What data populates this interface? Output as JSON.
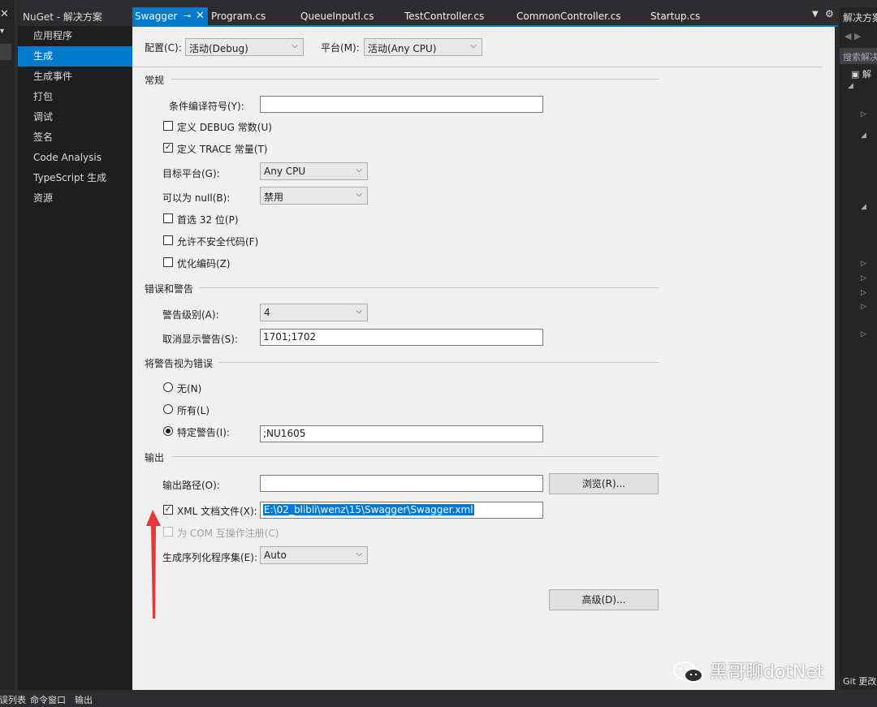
{
  "left_sliver": {
    "close_glyph": "✕",
    "dropdown_glyph": "▾"
  },
  "nuget_tab": {
    "label": "NuGet - 解决方案"
  },
  "project_nav": {
    "items": [
      "应用程序",
      "生成",
      "生成事件",
      "打包",
      "调试",
      "签名",
      "Code Analysis",
      "TypeScript 生成",
      "资源"
    ],
    "active_index": 1
  },
  "tabs": {
    "active": {
      "label": "Swagger",
      "pin": "⊸",
      "close": "✕"
    },
    "others": [
      "Program.cs",
      "QueueInputl.cs",
      "TestController.cs",
      "CommonController.cs",
      "Startup.cs"
    ],
    "menu_glyph": "▼",
    "gear_glyph": "⚙"
  },
  "config": {
    "config_label": "配置(C):",
    "config_value": "活动(Debug)",
    "platform_label": "平台(M):",
    "platform_value": "活动(Any CPU)"
  },
  "general": {
    "title": "常规",
    "conditional_label": "条件编译符号(Y):",
    "conditional_value": "",
    "define_debug": {
      "label": "定义 DEBUG 常数(U)",
      "checked": false
    },
    "define_trace": {
      "label": "定义 TRACE 常量(T)",
      "checked": true
    },
    "target_label": "目标平台(G):",
    "target_value": "Any CPU",
    "nullable_label": "可以为 null(B):",
    "nullable_value": "禁用",
    "prefer32": {
      "label": "首选 32 位(P)",
      "checked": false
    },
    "unsafe": {
      "label": "允许不安全代码(F)",
      "checked": false
    },
    "optimize": {
      "label": "优化编码(Z)",
      "checked": false
    }
  },
  "errors": {
    "title": "错误和警告",
    "level_label": "警告级别(A):",
    "level_value": "4",
    "suppress_label": "取消显示警告(S):",
    "suppress_value": "1701;1702"
  },
  "treat_errors": {
    "title": "将警告视为错误",
    "none_label": "无(N)",
    "all_label": "所有(L)",
    "specific_label": "特定警告(I):",
    "selected": "specific",
    "specific_value": ";NU1605"
  },
  "output": {
    "title": "输出",
    "path_label": "输出路径(O):",
    "path_value": "",
    "browse_label": "浏览(R)...",
    "xml_doc": {
      "label": "XML 文档文件(X):",
      "checked": true,
      "value": "E:\\02_blibli\\wenz\\15\\Swagger\\Swagger.xml"
    },
    "com_interop": {
      "label": "为 COM 互操作注册(C)",
      "checked": false,
      "disabled": true
    },
    "serialization_label": "生成序列化程序集(E):",
    "serialization_value": "Auto",
    "advanced_label": "高级(D)..."
  },
  "solution_explorer": {
    "title": "解决方案资源管理器",
    "search_placeholder": "搜索解决方案资源管理器",
    "root_label": "解",
    "git_label": "Git 更改"
  },
  "statusbar": {
    "items": [
      "错误列表",
      "命令窗口",
      "输出"
    ]
  },
  "watermark": {
    "text": "黑哥聊dotNet"
  },
  "colors": {
    "accent": "#007acc",
    "annotation_arrow": "#e53935"
  }
}
